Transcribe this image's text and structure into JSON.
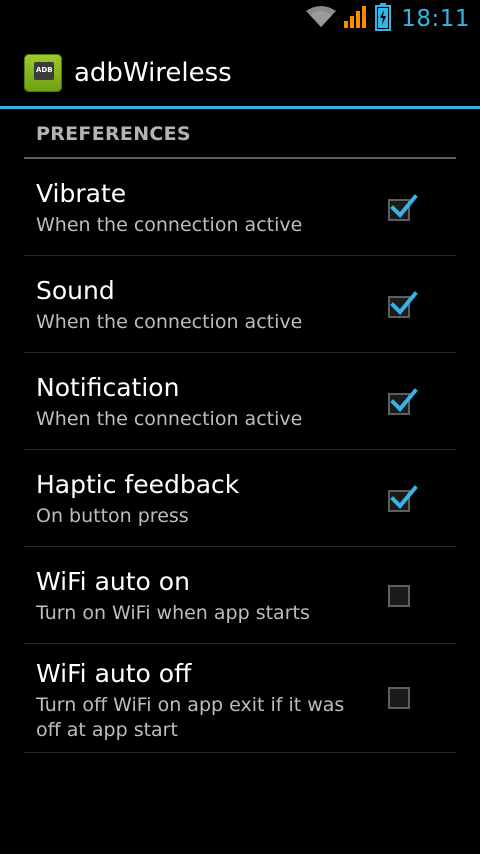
{
  "status_bar": {
    "time": "18:11",
    "icons": [
      "wifi-icon",
      "signal-icon",
      "battery-charging-icon"
    ],
    "accent_color": "#33b5e5",
    "signal_color": "#ff8a00"
  },
  "action_bar": {
    "app_icon": "adb-app-icon",
    "app_icon_text": "ADB",
    "title": "adbWireless",
    "accent_color": "#33b5e5"
  },
  "preferences": {
    "category": "PREFERENCES",
    "items": [
      {
        "title": "Vibrate",
        "summary": "When the connection active",
        "checked": true
      },
      {
        "title": "Sound",
        "summary": "When the connection active",
        "checked": true
      },
      {
        "title": "Notification",
        "summary": "When the connection active",
        "checked": true
      },
      {
        "title": "Haptic feedback",
        "summary": "On button press",
        "checked": true
      },
      {
        "title": "WiFi auto on",
        "summary": "Turn on WiFi when app starts",
        "checked": false
      },
      {
        "title": "WiFi auto off",
        "summary": "Turn off WiFi on app exit if it was off at app start",
        "checked": false
      }
    ]
  }
}
